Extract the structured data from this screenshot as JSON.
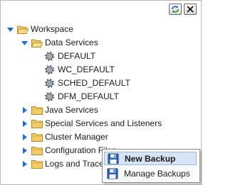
{
  "toolbar": {
    "refresh_icon": "refresh-icon",
    "close_icon": "close-icon"
  },
  "tree": {
    "workspace": "Workspace",
    "data_services": "Data Services",
    "services": [
      "DEFAULT",
      "WC_DEFAULT",
      "SCHED_DEFAULT",
      "DFM_DEFAULT"
    ],
    "java_services": "Java Services",
    "special_services": "Special Services and Listeners",
    "cluster_manager": "Cluster Manager",
    "configuration_files": "Configuration Files",
    "logs_and_traces": "Logs and Traces"
  },
  "context_menu": {
    "new_backup": "New Backup",
    "manage_backups": "Manage Backups"
  },
  "colors": {
    "folder": "#e8b84a",
    "twisty": "#1f6fd1",
    "menu_highlight": "#d6e4f6"
  }
}
